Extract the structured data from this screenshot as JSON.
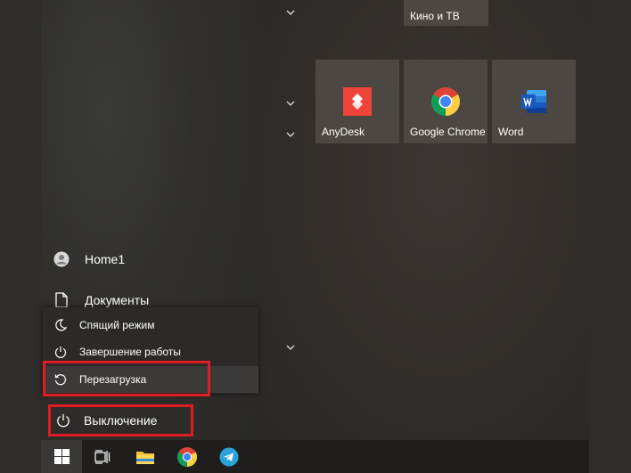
{
  "tiles": {
    "top": {
      "label": "Кино и ТВ"
    },
    "apps": [
      {
        "label": "AnyDesk",
        "icon": "anydesk-icon"
      },
      {
        "label": "Google Chrome",
        "icon": "chrome-icon"
      },
      {
        "label": "Word",
        "icon": "word-icon"
      }
    ]
  },
  "nav": {
    "user_label": "Home1",
    "documents_label": "Документы"
  },
  "power_menu": {
    "items": [
      {
        "label": "Спящий режим",
        "icon": "moon-icon"
      },
      {
        "label": "Завершение работы",
        "icon": "power-icon"
      },
      {
        "label": "Перезагрузка",
        "icon": "restart-icon"
      }
    ]
  },
  "power_button": {
    "label": "Выключение",
    "icon": "power-icon"
  },
  "taskbar": {
    "items": [
      "windows-start-icon",
      "task-view-icon",
      "file-explorer-icon",
      "chrome-icon",
      "telegram-icon"
    ]
  },
  "colors": {
    "highlight": "#e01b24",
    "tile": "#4c4743",
    "taskbar": "#1f1e1d"
  }
}
